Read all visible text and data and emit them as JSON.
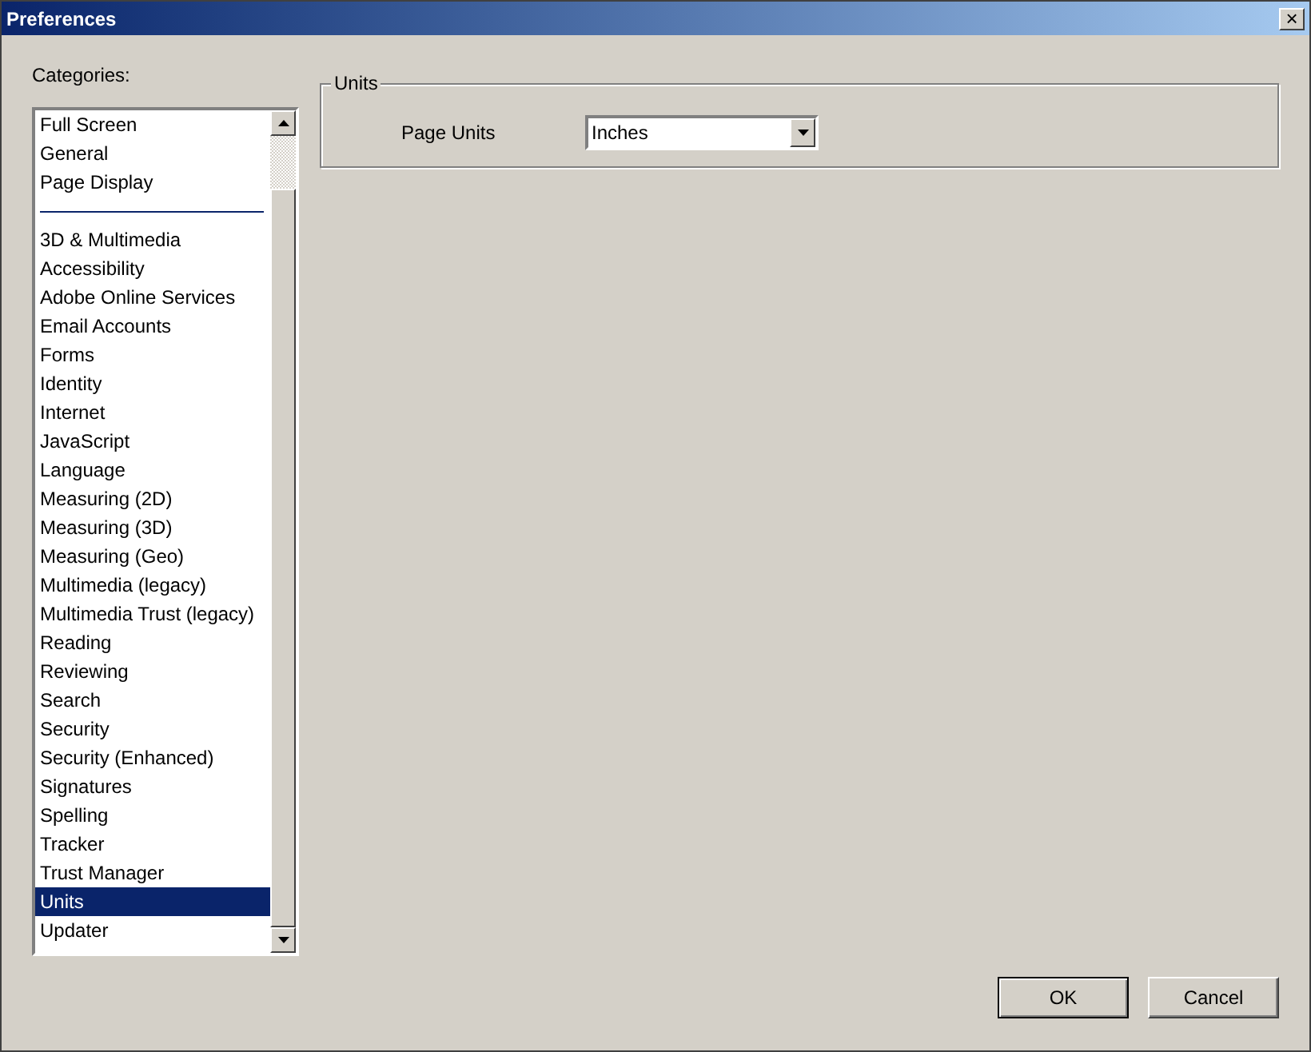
{
  "window": {
    "title": "Preferences",
    "close": "×"
  },
  "categories": {
    "label": "Categories:",
    "items": [
      {
        "kind": "item",
        "label": "Full Screen",
        "selected": false
      },
      {
        "kind": "item",
        "label": "General",
        "selected": false
      },
      {
        "kind": "item",
        "label": "Page Display",
        "selected": false
      },
      {
        "kind": "separator"
      },
      {
        "kind": "item",
        "label": "3D & Multimedia",
        "selected": false
      },
      {
        "kind": "item",
        "label": "Accessibility",
        "selected": false
      },
      {
        "kind": "item",
        "label": "Adobe Online Services",
        "selected": false
      },
      {
        "kind": "item",
        "label": "Email Accounts",
        "selected": false
      },
      {
        "kind": "item",
        "label": "Forms",
        "selected": false
      },
      {
        "kind": "item",
        "label": "Identity",
        "selected": false
      },
      {
        "kind": "item",
        "label": "Internet",
        "selected": false
      },
      {
        "kind": "item",
        "label": "JavaScript",
        "selected": false
      },
      {
        "kind": "item",
        "label": "Language",
        "selected": false
      },
      {
        "kind": "item",
        "label": "Measuring (2D)",
        "selected": false
      },
      {
        "kind": "item",
        "label": "Measuring (3D)",
        "selected": false
      },
      {
        "kind": "item",
        "label": "Measuring (Geo)",
        "selected": false
      },
      {
        "kind": "item",
        "label": "Multimedia (legacy)",
        "selected": false
      },
      {
        "kind": "item",
        "label": "Multimedia Trust (legacy)",
        "selected": false
      },
      {
        "kind": "item",
        "label": "Reading",
        "selected": false
      },
      {
        "kind": "item",
        "label": "Reviewing",
        "selected": false
      },
      {
        "kind": "item",
        "label": "Search",
        "selected": false
      },
      {
        "kind": "item",
        "label": "Security",
        "selected": false
      },
      {
        "kind": "item",
        "label": "Security (Enhanced)",
        "selected": false
      },
      {
        "kind": "item",
        "label": "Signatures",
        "selected": false
      },
      {
        "kind": "item",
        "label": "Spelling",
        "selected": false
      },
      {
        "kind": "item",
        "label": "Tracker",
        "selected": false
      },
      {
        "kind": "item",
        "label": "Trust Manager",
        "selected": false
      },
      {
        "kind": "item",
        "label": "Units",
        "selected": true
      },
      {
        "kind": "item",
        "label": "Updater",
        "selected": false
      }
    ]
  },
  "units_group": {
    "title": "Units",
    "page_units": {
      "label": "Page Units",
      "value": "Inches"
    }
  },
  "buttons": [
    "OK",
    "Cancel"
  ]
}
